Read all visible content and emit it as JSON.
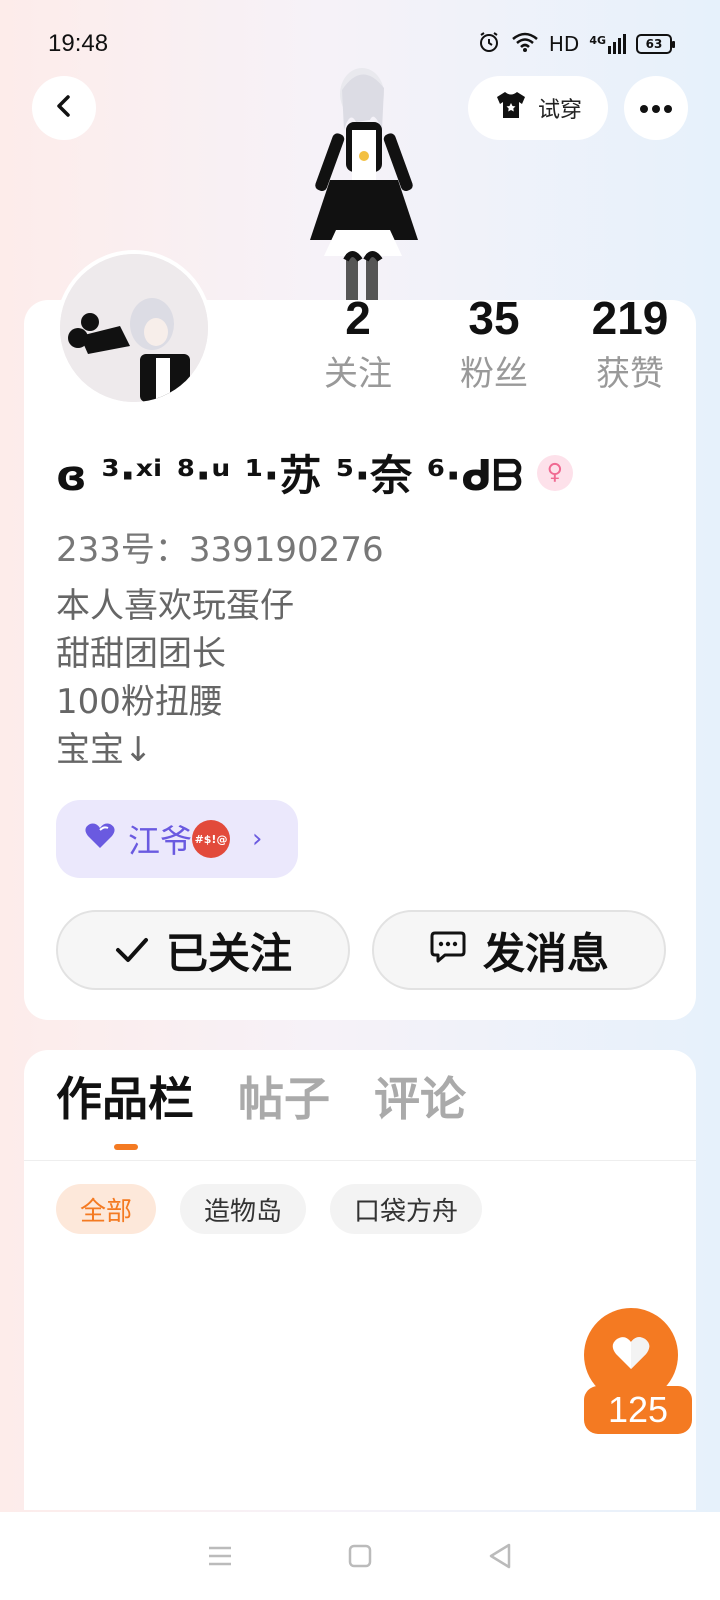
{
  "status": {
    "time": "19:48",
    "network": "HD",
    "signal": "4G",
    "battery": "63"
  },
  "header": {
    "tryon_label": "试穿",
    "back_icon": "chevron-left-icon",
    "more_icon": "ellipsis-icon",
    "tryon_icon": "tshirt-icon"
  },
  "profile": {
    "stats": [
      {
        "value": "2",
        "label": "关注"
      },
      {
        "value": "35",
        "label": "粉丝"
      },
      {
        "value": "219",
        "label": "获赞"
      }
    ],
    "username": "ɞ ³·ˣⁱ ⁸·ᵘ ¹·苏 ⁵·奈 ⁶·ᑯᗷ",
    "gender_symbol": "♀",
    "uid": "233号：339190276",
    "bio": [
      "本人喜欢玩蛋仔",
      "甜甜团团长",
      "100粉扭腰",
      "宝宝↓"
    ],
    "guild": {
      "label": "江爷",
      "emoji_text": "#$!@"
    },
    "follow_button": "已关注",
    "message_button": "发消息"
  },
  "content": {
    "tabs": [
      "作品栏",
      "帖子",
      "评论"
    ],
    "chips": [
      "全部",
      "造物岛",
      "口袋方舟"
    ]
  },
  "like": {
    "count": "125"
  },
  "colors": {
    "accent": "#f47a22",
    "purple": "#6a5ae0",
    "pink": "#f06a92"
  }
}
